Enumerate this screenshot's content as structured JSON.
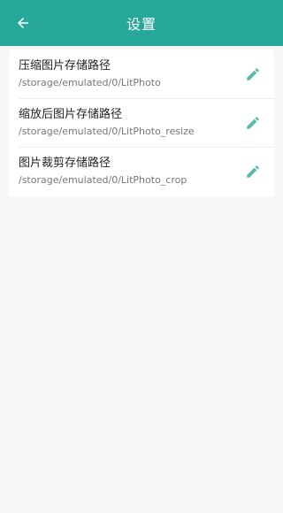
{
  "header": {
    "title": "设置",
    "back_icon": "arrow-back-icon"
  },
  "settings": {
    "items": [
      {
        "label": "压缩图片存储路径",
        "path": "/storage/emulated/0/LitPhoto",
        "icon": "edit-pencil-icon"
      },
      {
        "label": "缩放后图片存储路径",
        "path": "/storage/emulated/0/LitPhoto_resize",
        "icon": "edit-pencil-icon"
      },
      {
        "label": "图片裁剪存储路径",
        "path": "/storage/emulated/0/LitPhoto_crop",
        "icon": "edit-pencil-icon"
      }
    ]
  },
  "colors": {
    "accent": "#27a89a",
    "icon": "#5cb8ad",
    "background": "#f7f7f7"
  }
}
